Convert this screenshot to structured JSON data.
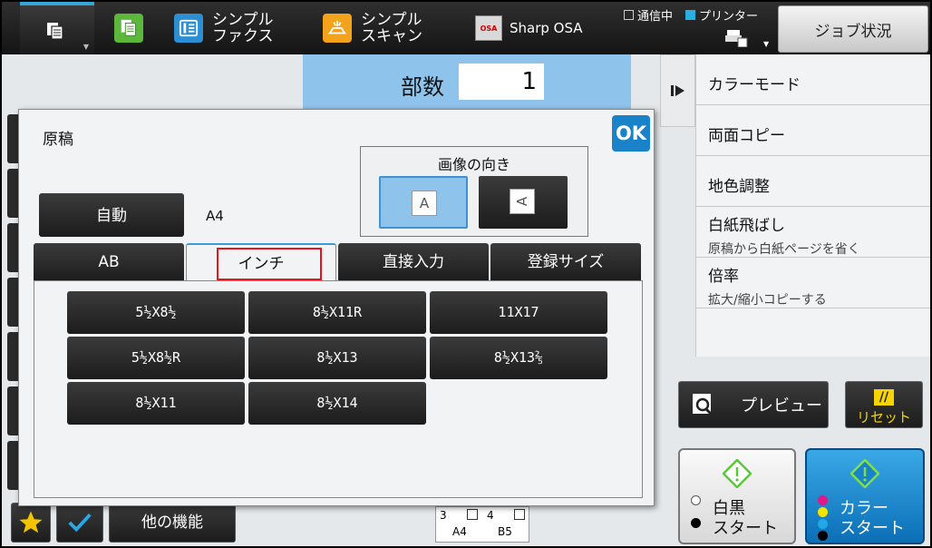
{
  "topbar": {
    "items": [
      {
        "label": "シンプル\nファクス",
        "icon": "fax-icon"
      },
      {
        "label": "シンプル\nスキャン",
        "icon": "scan-icon"
      },
      {
        "label": "Sharp OSA",
        "icon": "osa-icon",
        "icon_text": "OSA"
      }
    ],
    "status_comm": "通信中",
    "status_printer": "プリンター",
    "job_status": "ジョブ状況"
  },
  "copies": {
    "label": "部数",
    "value": "1"
  },
  "right_panel": {
    "items": [
      {
        "title": "カラーモード"
      },
      {
        "title": "両面コピー"
      },
      {
        "title": "地色調整"
      },
      {
        "title": "白紙飛ばし",
        "sub": "原稿から白紙ページを省く"
      },
      {
        "title": "倍率",
        "sub": "拡大/縮小コピーする"
      }
    ]
  },
  "actions": {
    "preview": "プレビュー",
    "reset": "リセット",
    "bw_start": "白黒\nスタート",
    "color_start": "カラー\nスタート"
  },
  "bottom": {
    "other_functions": "他の機能"
  },
  "trays": [
    {
      "num": "3",
      "size": "A4"
    },
    {
      "num": "4",
      "size": "B5"
    }
  ],
  "dialog": {
    "title": "原稿",
    "ok": "OK",
    "auto": "自動",
    "size": "A4",
    "orientation": {
      "label": "画像の向き",
      "option1": "A",
      "option2": "A"
    },
    "tabs": [
      "AB",
      "インチ",
      "直接入力",
      "登録サイズ"
    ],
    "active_tab": "インチ",
    "sizes": [
      "5½X8½",
      "8½X11R",
      "11X17",
      "5½X8½R",
      "8½X13",
      "8½X13⅖",
      "8½X11",
      "8½X14"
    ]
  },
  "colors": {
    "accent": "#3a9ad6",
    "highlight": "#e8131b",
    "copies_bg": "#8ec4ec",
    "start_blue": "#1a82c8",
    "reset_yellow": "#f5d400"
  }
}
